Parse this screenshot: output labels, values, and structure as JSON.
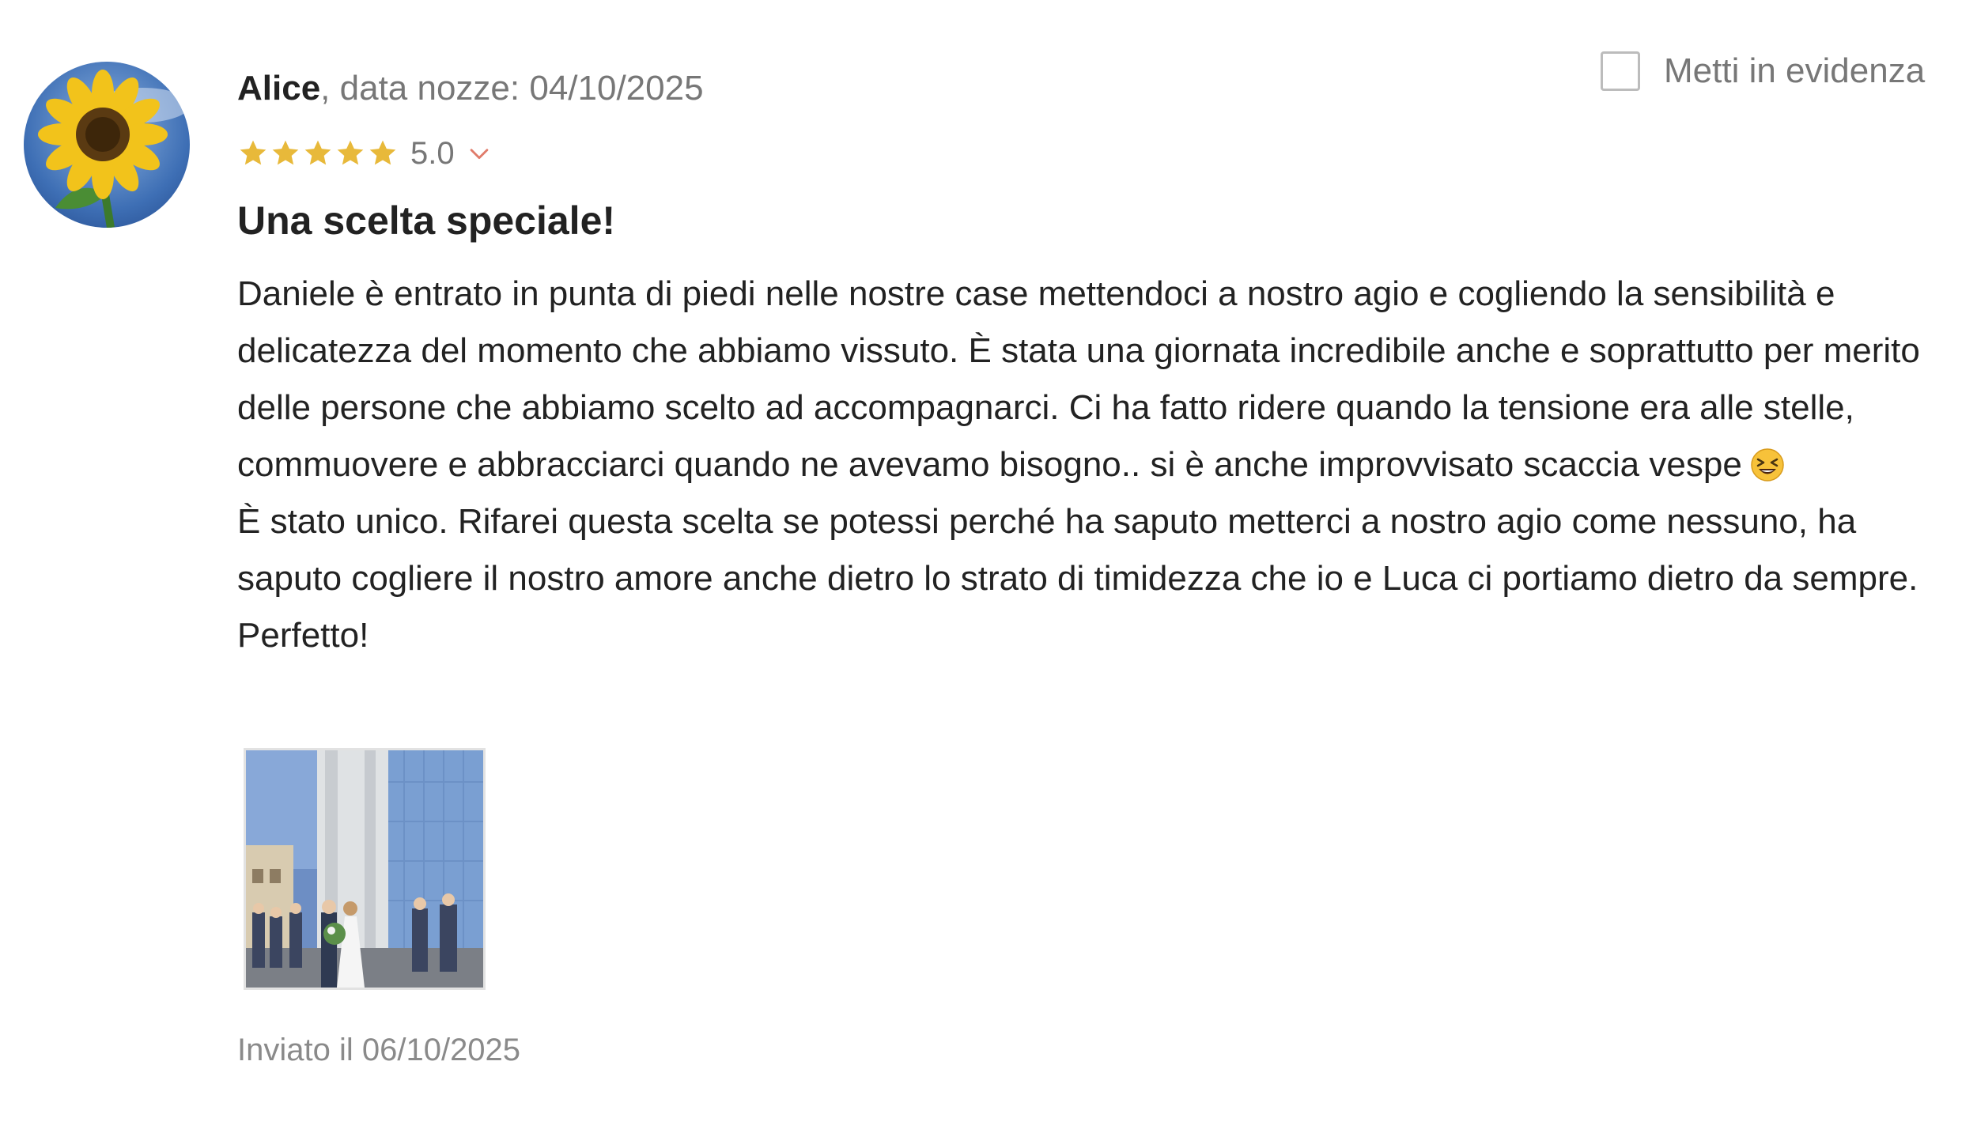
{
  "review": {
    "author_name": "Alice",
    "wedding_date_text": ", data nozze: 04/10/2025",
    "highlight_label": "Metti in evidenza",
    "rating": {
      "stars": 5,
      "value_text": "5.0"
    },
    "title": "Una scelta speciale!",
    "body_paragraph_1": "Daniele è entrato in punta di piedi nelle nostre case mettendoci a nostro agio e cogliendo la sensibilità e delicatezza del momento che abbiamo vissuto. È stata una giornata incredibile anche e soprattutto per merito delle persone che abbiamo scelto ad accompagnarci. Ci ha fatto ridere quando la tensione era alle stelle, commuovere e abbracciarci quando ne avevamo bisogno.. si è anche improvvisato scaccia vespe",
    "body_paragraph_2": "È stato unico. Rifarei questa scelta se potessi perché ha saputo metterci a nostro agio come nessuno, ha saputo cogliere il nostro amore anche dietro lo strato di timidezza che io e Luca ci portiamo dietro da sempre. Perfetto!",
    "sent_text": "Inviato il 06/10/2025"
  },
  "icons": {
    "avatar": "sunflower-avatar",
    "star": "star-icon",
    "chevron": "chevron-down-icon",
    "emoji": "laughing-squinting-face-emoji",
    "photo": "wedding-photo-thumbnail"
  },
  "colors": {
    "star": "#e8b93a",
    "chevron": "#e07b6a",
    "text_primary": "#222222",
    "text_secondary": "#777777",
    "checkbox_border": "#bcbcbc"
  }
}
